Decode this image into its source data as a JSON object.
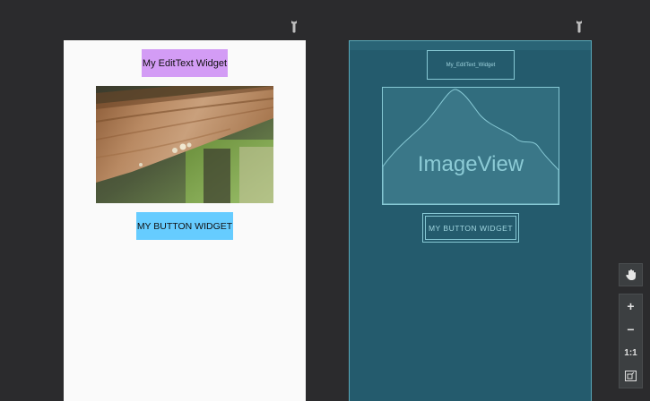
{
  "design_view": {
    "edittext_label": "My EditText Widget",
    "button_label": "MY BUTTON WIDGET",
    "edittext_color": "#d39cf5",
    "button_color": "#66ccff",
    "background_color": "#fafafa"
  },
  "blueprint_view": {
    "edittext_label": "My_EditText_Widget",
    "imageview_label": "ImageView",
    "button_label": "MY BUTTON WIDGET",
    "background_color": "#245b6d",
    "outline_color": "#86c8d4"
  },
  "toolbar": {
    "pan_icon": "hand-icon",
    "zoom_in_label": "+",
    "zoom_out_label": "−",
    "actual_size_label": "1:1",
    "fit_icon": "zoom-to-fit-icon"
  },
  "icons": {
    "wrench": "wrench-icon"
  }
}
